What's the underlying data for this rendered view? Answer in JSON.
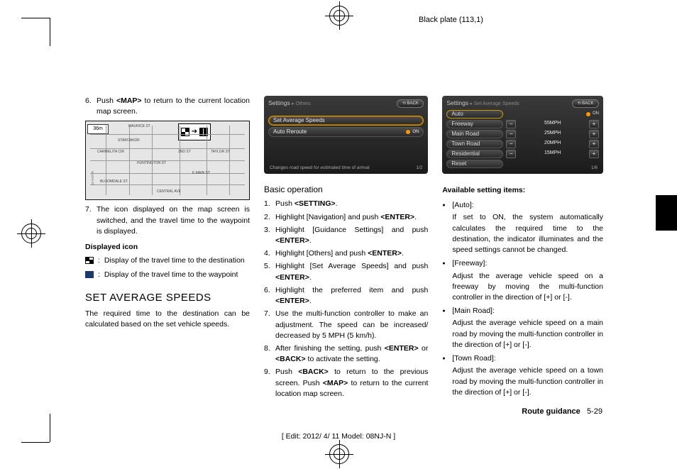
{
  "header": {
    "plate": "Black plate (113,1)"
  },
  "col1": {
    "step6": {
      "num": "6.",
      "text_a": "Push ",
      "map": "<MAP>",
      "text_b": " to return to the current location map screen."
    },
    "map": {
      "badge": "36m",
      "streets": [
        "MAURICE ST",
        "STAROAKDR",
        "CARMELITA CIR",
        "TAYLOR ST",
        "2ND ST",
        "HUNTINGTON ST",
        "E MAIN ST",
        "BLOOMDALE ST",
        "CENTRAL AVE",
        "N 13TH ST"
      ]
    },
    "step7": {
      "num": "7.",
      "text": "The icon displayed on the map screen is switched, and the travel time to the waypoint is displayed."
    },
    "displayed_icon_h": "Displayed icon",
    "icon1": "Display of the travel time to the destination",
    "icon2": "Display of the travel time to the waypoint",
    "section_h": "SET AVERAGE SPEEDS",
    "section_p": "The required time to the destination can be calculated based on the set vehicle speeds."
  },
  "col2": {
    "ui": {
      "crumb_main": "Settings",
      "crumb_sub": "Others",
      "back": "⟲ BACK",
      "row_sel": "Set Average Speeds",
      "row2": "Auto Reroute",
      "row2_state": "ON",
      "caption": "Changes road speed for estimated time of arrival",
      "pager": "1/2"
    },
    "basic_h": "Basic operation",
    "steps": [
      {
        "num": "1.",
        "parts": [
          "Push ",
          "<SETTING>",
          "."
        ]
      },
      {
        "num": "2.",
        "parts": [
          "Highlight [Navigation] and push ",
          "<ENTER>",
          "."
        ]
      },
      {
        "num": "3.",
        "parts": [
          "Highlight [Guidance Settings] and push ",
          "<ENTER>",
          "."
        ]
      },
      {
        "num": "4.",
        "parts": [
          "Highlight [Others] and push ",
          "<ENTER>",
          "."
        ]
      },
      {
        "num": "5.",
        "parts": [
          "Highlight [Set Average Speeds] and push ",
          "<ENTER>",
          "."
        ]
      },
      {
        "num": "6.",
        "parts": [
          "Highlight the preferred item and push ",
          "<ENTER>",
          "."
        ]
      },
      {
        "num": "7.",
        "plain": "Use the multi-function controller to make an adjustment. The speed can be increased/ decreased by 5 MPH (5 km/h)."
      },
      {
        "num": "8.",
        "parts": [
          "After finishing the setting, push ",
          "<ENTER>",
          " or ",
          "<BACK>",
          " to activate the setting."
        ]
      },
      {
        "num": "9.",
        "parts": [
          "Push ",
          "<BACK>",
          " to return to the previous screen. Push ",
          "<MAP>",
          " to return to the current location map screen."
        ]
      }
    ]
  },
  "col3": {
    "ui": {
      "crumb_main": "Settings",
      "crumb_sub": "Set Average Speeds",
      "back": "⟲ BACK",
      "rows": [
        {
          "name": "Auto",
          "switch": "ON",
          "sel": true
        },
        {
          "name": "Freeway",
          "val": "55MPH"
        },
        {
          "name": "Main Road",
          "val": "25MPH"
        },
        {
          "name": "Town Road",
          "val": "20MPH"
        },
        {
          "name": "Residential",
          "val": "15MPH"
        },
        {
          "name": "Reset"
        }
      ],
      "pager": "1/6"
    },
    "avail_h": "Available setting items:",
    "items": [
      {
        "name": "[Auto]:",
        "desc": "If set to ON, the system automatically calculates the required time to the destination, the indicator illuminates and the speed settings cannot be changed."
      },
      {
        "name": "[Freeway]:",
        "desc": "Adjust the average vehicle speed on a freeway by moving the multi-function controller in the direction of [+] or [-]."
      },
      {
        "name": "[Main Road]:",
        "desc": "Adjust the average vehicle speed on a main road by moving the multi-function controller in the direction of [+] or [-]."
      },
      {
        "name": "[Town Road]:",
        "desc": "Adjust the average vehicle speed on a town road by moving the multi-function controller in the direction of [+] or [-]."
      }
    ]
  },
  "footer": {
    "section": "Route guidance",
    "page": "5-29",
    "edit": "[ Edit: 2012/ 4/ 11   Model:  08NJ-N ]"
  }
}
